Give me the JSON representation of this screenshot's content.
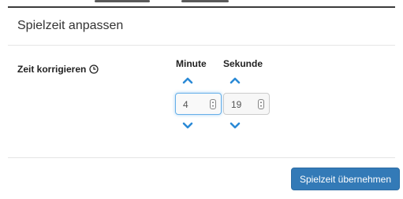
{
  "dialog": {
    "title": "Spielzeit anpassen"
  },
  "time_editor": {
    "label": "Zeit korrigieren",
    "label_icon": "clock-icon",
    "minute_header": "Minute",
    "second_header": "Sekunde",
    "minute_value": "4",
    "second_value": "19",
    "increment_icon": "chevron-up-icon",
    "decrement_icon": "chevron-down-icon"
  },
  "footer": {
    "apply_label": "Spielzeit übernehmen"
  },
  "colors": {
    "accent": "#337ab7",
    "chevron": "#2b8ad6",
    "focus_border": "#66afe9"
  }
}
